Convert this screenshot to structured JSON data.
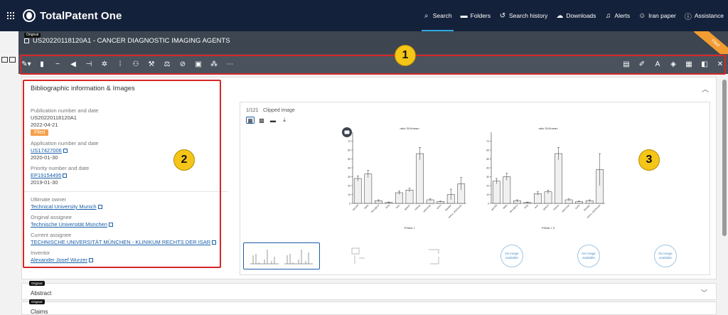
{
  "nav": {
    "brand": "TotalPatent One",
    "links": [
      {
        "icon": "search-icon",
        "label": "Search",
        "active": true
      },
      {
        "icon": "folder-icon",
        "label": "Folders",
        "active": false
      },
      {
        "icon": "history-icon",
        "label": "Search history",
        "active": false
      },
      {
        "icon": "cloud-download-icon",
        "label": "Downloads",
        "active": false
      },
      {
        "icon": "bell-icon",
        "label": "Alerts",
        "active": false
      },
      {
        "icon": "user-icon",
        "label": "Iran paper",
        "active": false
      },
      {
        "icon": "info-icon",
        "label": "Assistance",
        "active": false
      }
    ]
  },
  "document": {
    "original_tag": "Original",
    "title": "US20220118120A1 - CANCER DIAGNOSTIC IMAGING AGENTS",
    "status_corner": "Filed"
  },
  "toolbar": {
    "left_icons": [
      "pen-icon",
      "bookmark-icon",
      "minus-icon",
      "megaphone-icon",
      "tree-icon",
      "sparkle-tree-icon",
      "bar-list-icon",
      "people-icon",
      "hammer-icon",
      "scale-icon",
      "tag-icon",
      "comment-icon",
      "network-icon",
      "more-icon"
    ],
    "right_icons": [
      "document-icon",
      "edit-icon",
      "translate-icon",
      "shield-icon",
      "save-icon",
      "panel-icon",
      "close-icon"
    ]
  },
  "annotations": {
    "badge1": "1",
    "badge2": "2",
    "badge3": "3"
  },
  "biblio": {
    "heading": "Bibliographic information & Images",
    "pub_label": "Publication number and date",
    "pub_number": "US20220118120A1",
    "pub_date": "2022-04-21",
    "status_chip": "Filed",
    "app_label": "Application number and date",
    "app_number": "US17427006",
    "app_date": "2020-01-30",
    "prio_label": "Priority number and date",
    "prio_number": "EP19154495",
    "prio_date": "2019-01-30",
    "owner_label": "Ultimate owner",
    "owner": "Technical University Munich",
    "orig_assignee_label": "Original assignee",
    "orig_assignee": "Technische Universität München",
    "curr_assignee_label": "Current assignee",
    "curr_assignee": "TECHNISCHE UNIVERSITÄT MÜNCHEN - KLINIKUM RECHTS DER ISAR",
    "inventor_label": "Inventor",
    "inventor": "Alexander Josef Wurzer"
  },
  "viewer": {
    "count": "1/121",
    "clipped": "Clipped image",
    "no_image_text": "No image available"
  },
  "chart_data": [
    {
      "type": "bar",
      "title": "ratio SUVmean",
      "xlabel": "PSMA-7",
      "categories": [
        "parotid",
        "SMG",
        "bloodpool",
        "lung",
        "liver",
        "spleen",
        "kidney",
        "pancreas",
        "bone",
        "bladder",
        "tumor_SUVmean"
      ],
      "values": [
        28,
        33,
        3,
        1,
        12,
        15,
        56,
        4,
        2,
        10,
        22
      ],
      "errors": [
        3,
        4,
        1,
        0.5,
        2,
        2,
        7,
        1,
        0.5,
        6,
        7
      ],
      "ylim": [
        0,
        80
      ],
      "yticks": [
        0,
        10,
        20,
        30,
        40,
        50,
        60,
        70
      ]
    },
    {
      "type": "bar",
      "title": "ratio SUVmean",
      "xlabel": "PSMA-7.3",
      "categories": [
        "parotid",
        "SMG",
        "bloodpool",
        "lung",
        "liver",
        "spleen",
        "kidney",
        "pancreas",
        "bone",
        "bladder",
        "tumor_SUVmean"
      ],
      "values": [
        25,
        30,
        3,
        1,
        11,
        13,
        56,
        4,
        2,
        3,
        38
      ],
      "errors": [
        3,
        4,
        1,
        0.5,
        2,
        2,
        7,
        1,
        0.5,
        1,
        18
      ],
      "ylim": [
        0,
        80
      ],
      "yticks": [
        0,
        10,
        20,
        30,
        40,
        50,
        60,
        70
      ]
    }
  ],
  "sections": [
    {
      "tag": "Original",
      "title": "Abstract"
    },
    {
      "tag": "Original",
      "title": "Claims"
    }
  ]
}
